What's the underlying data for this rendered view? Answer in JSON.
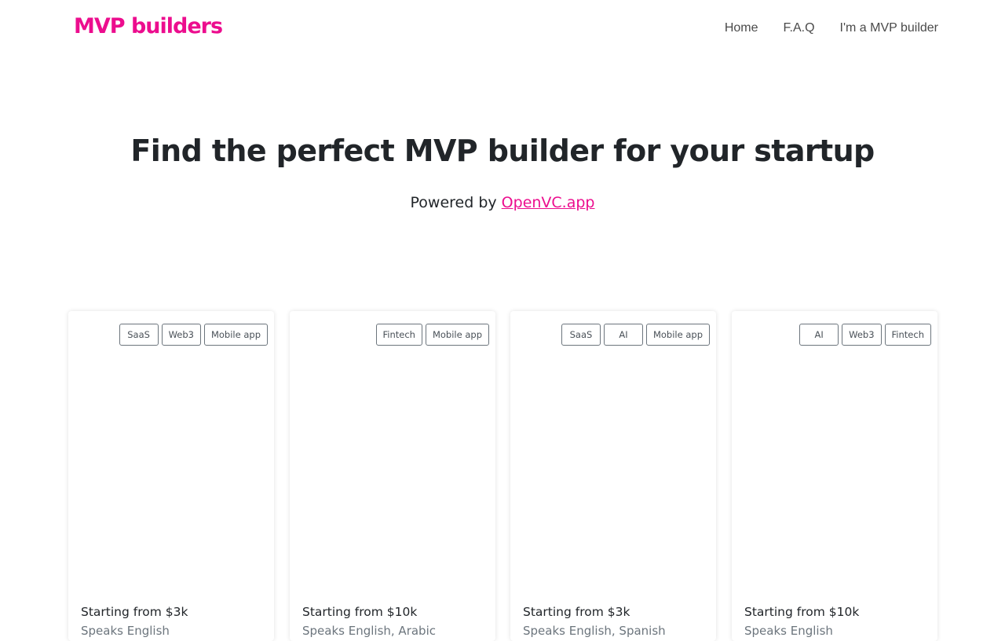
{
  "header": {
    "logo": "MVP builders",
    "nav": [
      "Home",
      "F.A.Q",
      "I'm a MVP builder"
    ]
  },
  "hero": {
    "title": "Find the perfect MVP builder for your startup",
    "powered_prefix": "Powered by ",
    "powered_link": "OpenVC.app"
  },
  "colors": {
    "accent": "#ec0d8e",
    "text": "#212529",
    "muted": "#6c757d"
  },
  "cards": [
    {
      "tags": [
        "SaaS",
        "Web3",
        "Mobile app"
      ],
      "price": "Starting from $3k",
      "languages": "Speaks English"
    },
    {
      "tags": [
        "Fintech",
        "Mobile app"
      ],
      "price": "Starting from $10k",
      "languages": "Speaks English, Arabic"
    },
    {
      "tags": [
        "SaaS",
        "AI",
        "Mobile app"
      ],
      "price": "Starting from $3k",
      "languages": "Speaks English, Spanish"
    },
    {
      "tags": [
        "AI",
        "Web3",
        "Fintech"
      ],
      "price": "Starting from $10k",
      "languages": "Speaks English"
    }
  ]
}
